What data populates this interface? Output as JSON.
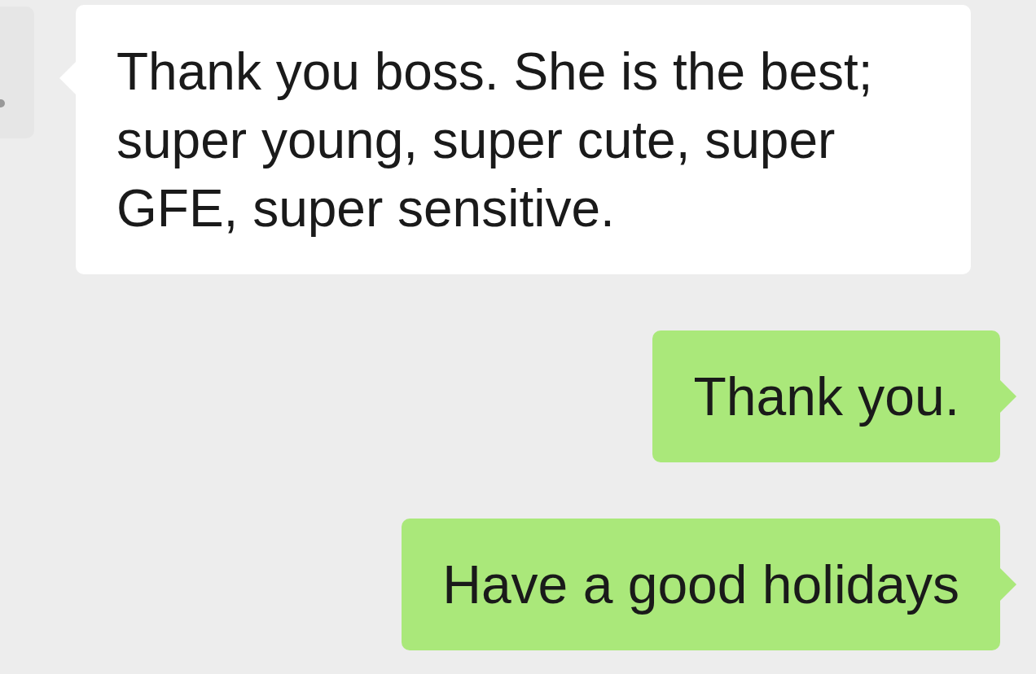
{
  "messages": [
    {
      "kind": "incoming",
      "text": "Thank you boss. She is the best; super young, super cute, super GFE, super sensitive."
    },
    {
      "kind": "outgoing",
      "text": "Thank you."
    },
    {
      "kind": "outgoing",
      "text": "Have a good holidays"
    }
  ]
}
